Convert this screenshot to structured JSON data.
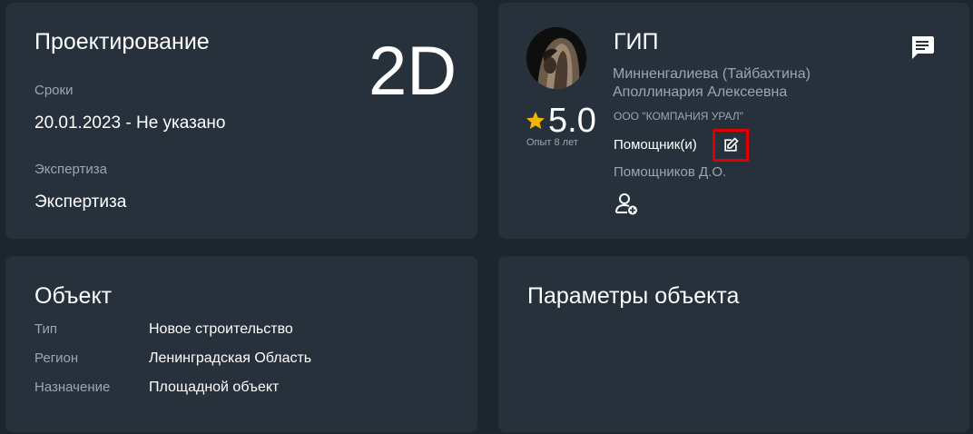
{
  "project": {
    "title": "Проектирование",
    "mode": "2D",
    "deadline_label": "Сроки",
    "deadline_value": "20.01.2023 - Не указано",
    "expertise_label": "Экспертиза",
    "expertise_value": "Экспертиза"
  },
  "gip": {
    "title": "ГИП",
    "name_line1": "Минненгалиева (Тайбахтина)",
    "name_line2": "Аполлинария Алексеевна",
    "company": "ООО \"КОМПАНИЯ УРАЛ\"",
    "rating": "5.0",
    "experience": "Опыт 8 лет",
    "helpers_label": "Помощник(и)",
    "helper_name": "Помощников Д.О.",
    "icons": {
      "star": "star-icon",
      "edit": "edit-icon",
      "add_user": "add-user-icon",
      "comment": "comment-icon",
      "avatar": "avatar"
    }
  },
  "object": {
    "title": "Объект",
    "rows": [
      {
        "label": "Тип",
        "value": "Новое строительство"
      },
      {
        "label": "Регион",
        "value": "Ленинградская Область"
      },
      {
        "label": "Назначение",
        "value": "Площадной объект"
      }
    ]
  },
  "params": {
    "title": "Параметры объекта"
  },
  "colors": {
    "background": "#1d262f",
    "card": "#27313c",
    "muted_text": "#9aa6b2",
    "star": "#f5b400",
    "highlight": "#e00000"
  }
}
